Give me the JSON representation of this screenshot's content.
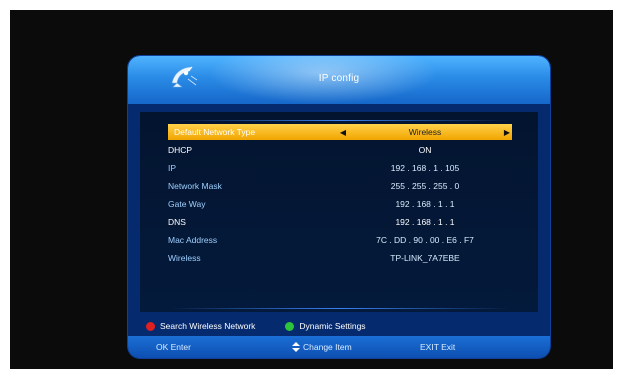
{
  "header": {
    "title": "IP config",
    "icon": "satellite-dish-icon"
  },
  "rows": [
    {
      "label": "Default Network Type",
      "value": "Wireless"
    },
    {
      "label": "DHCP",
      "value": "ON"
    },
    {
      "label": "IP",
      "value": "192 . 168 .  1  . 105"
    },
    {
      "label": "Network Mask",
      "value": "255 . 255 . 255 .  0"
    },
    {
      "label": "Gate Way",
      "value": "192 . 168 .  1  .  1"
    },
    {
      "label": "DNS",
      "value": "192 . 168 .  1  .  1"
    },
    {
      "label": "Mac Address",
      "value": "7C . DD . 90 . 00 . E6 . F7"
    },
    {
      "label": "Wireless",
      "value": "TP-LINK_7A7EBE"
    }
  ],
  "legend": {
    "red_label": "Search Wireless Network",
    "green_label": "Dynamic Settings"
  },
  "footer": {
    "ok": "OK Enter",
    "change": "Change Item",
    "exit": "EXIT Exit"
  },
  "colors": {
    "selected_bar": "#f5b400",
    "red_dot": "#e02020",
    "green_dot": "#2cc43a"
  }
}
